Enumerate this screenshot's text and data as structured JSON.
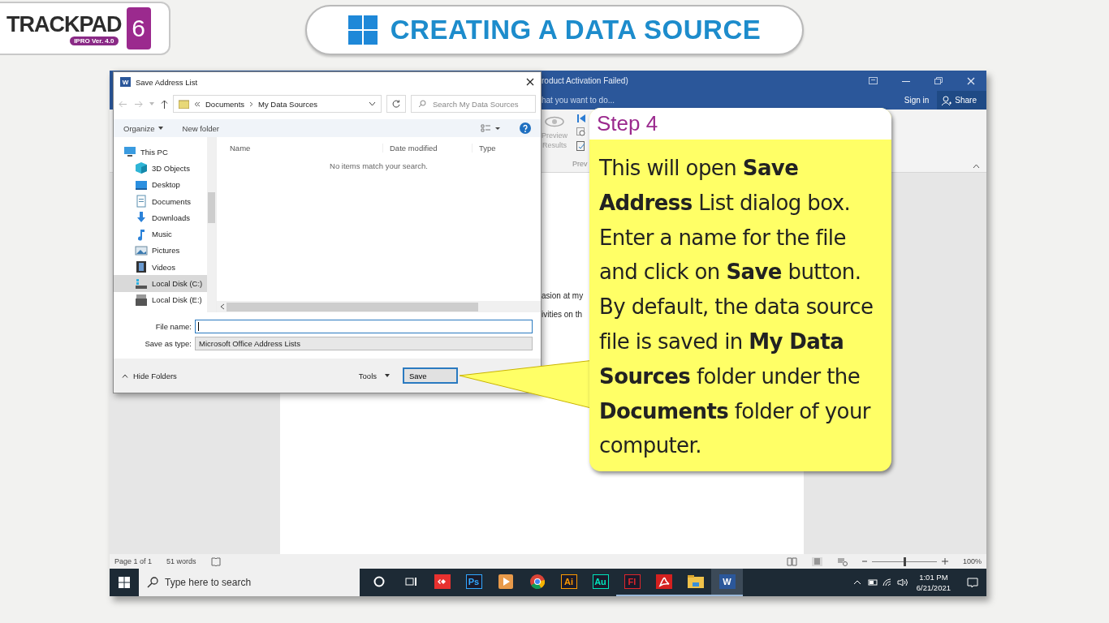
{
  "logo": {
    "wordmark": "TRACKPAD",
    "edition": "6",
    "version": "IPRO Ver. 4.0"
  },
  "banner": {
    "title": "CREATING A DATA SOURCE"
  },
  "word": {
    "title": "roduct Activation Failed)",
    "tell_me": "hat you want to do...",
    "sign_in": "Sign in",
    "share": "Share",
    "ribbon_button": "Preview Results",
    "ribbon_group": "Prev",
    "document_lines": [
      "asion at my",
      "ivities on th"
    ],
    "status": {
      "page": "Page 1 of 1",
      "words": "51 words",
      "zoom": "100%",
      "level": 0.5
    }
  },
  "dialog": {
    "icon_label": "W",
    "title": "Save Address List",
    "path": [
      "Documents",
      "My Data Sources"
    ],
    "search_placeholder": "Search My Data Sources",
    "organize": "Organize",
    "new_folder": "New folder",
    "nav": [
      {
        "label": "This PC",
        "kind": "pc",
        "selected": false,
        "children": [
          {
            "label": "3D Objects",
            "kind": "cube",
            "selected": false
          },
          {
            "label": "Desktop",
            "kind": "desktop",
            "selected": false
          },
          {
            "label": "Documents",
            "kind": "document",
            "selected": false
          },
          {
            "label": "Downloads",
            "kind": "download",
            "selected": false
          },
          {
            "label": "Music",
            "kind": "music",
            "selected": false
          },
          {
            "label": "Pictures",
            "kind": "picture",
            "selected": false
          },
          {
            "label": "Videos",
            "kind": "video",
            "selected": false
          },
          {
            "label": "Local Disk (C:)",
            "kind": "system-disk",
            "selected": true
          },
          {
            "label": "Local Disk (E:)",
            "kind": "disk",
            "selected": false
          }
        ]
      }
    ],
    "columns": [
      "Name",
      "Date modified",
      "Type"
    ],
    "empty_message": "No items match your search.",
    "file_name": {
      "label": "File name:"
    },
    "save_type": {
      "label": "Save as type:",
      "value": "Microsoft Office Address Lists"
    },
    "hide_folders": "Hide Folders",
    "tools": "Tools",
    "save": "Save"
  },
  "callout": {
    "heading": "Step 4",
    "text": "This will open **Save Address** List dialog box. Enter a name for the file and click on **Save** button. By default, the data source file is saved in **My Data Sources** folder under the **Documents** folder of your computer."
  },
  "taskbar": {
    "search_placeholder": "Type here to search",
    "apps": [
      {
        "kind": "circle",
        "running": false,
        "selected": false
      },
      {
        "kind": "taskview",
        "running": false,
        "selected": false
      },
      {
        "kind": "anydesk",
        "running": false,
        "selected": false
      },
      {
        "kind": "letter",
        "label": "Ps",
        "color": "#31a8ff",
        "running": false,
        "selected": false
      },
      {
        "kind": "media",
        "running": false,
        "selected": false
      },
      {
        "kind": "chrome",
        "running": false,
        "selected": false
      },
      {
        "kind": "letter",
        "label": "Ai",
        "color": "#ff9a00",
        "running": false,
        "selected": false
      },
      {
        "kind": "letter",
        "label": "Au",
        "color": "#00e4bb",
        "running": false,
        "selected": false
      },
      {
        "kind": "letter",
        "label": "Fl",
        "color": "#e0252b",
        "running": true,
        "selected": false
      },
      {
        "kind": "acrobat",
        "running": true,
        "selected": false
      },
      {
        "kind": "folder",
        "running": true,
        "selected": false
      },
      {
        "kind": "word",
        "label": "W",
        "running": true,
        "selected": true
      }
    ],
    "time": "1:01 PM",
    "date": "6/21/2021"
  }
}
